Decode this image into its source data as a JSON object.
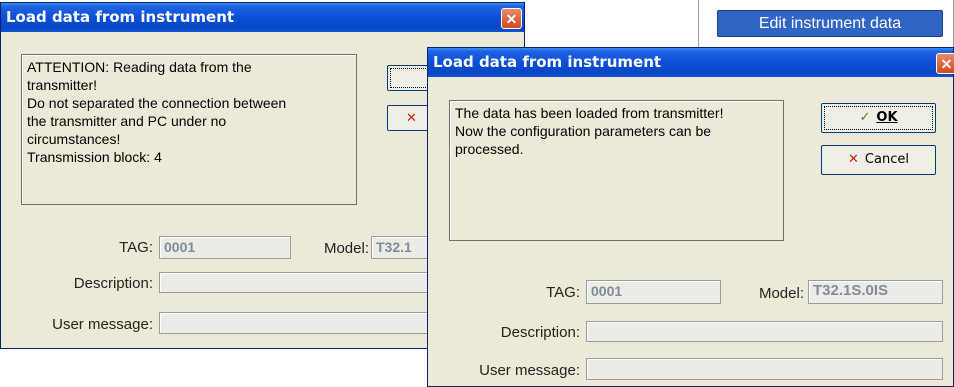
{
  "menu": {
    "item_label": "Edit instrument data"
  },
  "dialog1": {
    "title": "Load data from instrument",
    "close_glyph": "✕",
    "message": [
      "ATTENTION: Reading data from the",
      "transmitter!",
      "Do not separated the connection between",
      "the transmitter and PC under no",
      "circumstances!",
      "Transmission block: 4"
    ],
    "ok_icon": "check-icon",
    "ok_glyph": "✓",
    "cancel_icon": "x-icon",
    "cancel_glyph": "✕",
    "tag_label": "TAG:",
    "tag_value": "0001",
    "model_label": "Model:",
    "model_value": "T32.1",
    "description_label": "Description:",
    "description_value": "",
    "user_message_label": "User message:",
    "user_message_value": ""
  },
  "dialog2": {
    "title": "Load data from instrument",
    "close_glyph": "✕",
    "message": [
      "The data has been loaded from transmitter!",
      "Now the configuration parameters can be",
      "processed."
    ],
    "ok_icon": "check-icon",
    "ok_glyph": "✓",
    "ok_label": "OK",
    "cancel_icon": "x-icon",
    "cancel_glyph": "✕",
    "cancel_label": "Cancel",
    "tag_label": "TAG:",
    "tag_value": "0001",
    "model_label": "Model:",
    "model_value": "T32.1S.0IS",
    "description_label": "Description:",
    "description_value": "",
    "user_message_label": "User message:",
    "user_message_value": ""
  },
  "colors": {
    "title_bar": "#0a4fd8",
    "dialog_bg": "#ece9d8",
    "ok_check": "#2e8b1e",
    "cancel_x": "#c8201a",
    "menu_highlight": "#3165c4"
  }
}
